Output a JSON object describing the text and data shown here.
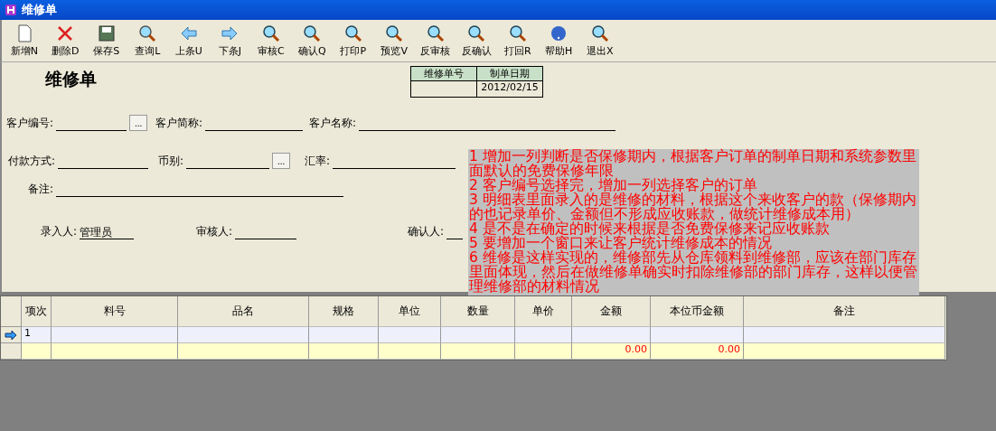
{
  "window": {
    "title": "维修单"
  },
  "toolbar": [
    "新增N",
    "删除D",
    "保存S",
    "查询L",
    "上条U",
    "下条J",
    "审核C",
    "确认Q",
    "打印P",
    "预览V",
    "反审核",
    "反确认",
    "打回R",
    "帮助H",
    "退出X"
  ],
  "form": {
    "heading": "维修单",
    "doc_table": {
      "columns": [
        {
          "header": "维修单号"
        },
        {
          "header": "制单日期",
          "value": "2012/02/15"
        }
      ]
    },
    "rows": [
      [
        {
          "label": "客户编号:",
          "lookup": "..."
        },
        {
          "label": "客户简称:"
        },
        {
          "label": "客户名称:"
        }
      ],
      [
        {
          "label": "付款方式:"
        },
        {
          "label": "币别:",
          "lookup": "..."
        },
        {
          "label": "汇率:"
        }
      ],
      [
        {
          "label": "备注:"
        }
      ],
      [
        {
          "label": "录入人:",
          "value": "管理员"
        },
        {
          "label": "审核人:"
        },
        {
          "label": "确认人:"
        }
      ]
    ]
  },
  "note": [
    "1 增加一列判断是否保修期内，根据客户订单的制单日期和系统参数里面默认的免费保修年限",
    "2 客户编号选择完，增加一列选择客户的订单",
    "3 明细表里面录入的是维修的材料，根据这个来收客户的款（保修期内的也记录单价、金额但不形成应收账款，做统计维修成本用）",
    "4 是不是在确定的时候来根据是否免费保修来记应收账款",
    "5 要增加一个窗口来让客户统计维修成本的情况",
    "6 维修是这样实现的，维修部先从仓库领料到维修部，应该在部门库存里面体现，然后在做维修单确实时扣除维修部的部门库存，这样以便管理维修部的材料情况"
  ],
  "grid": {
    "columns": [
      "项次",
      "料号",
      "品名",
      "规格",
      "单位",
      "数量",
      "单价",
      "金额",
      "本位币金额",
      "备注"
    ],
    "rows": [
      {
        "kind": "item",
        "selected": true,
        "cells": [
          "1",
          null,
          null,
          null,
          null,
          null,
          null,
          null,
          null,
          null
        ]
      },
      {
        "kind": "total",
        "selected": false,
        "cells": [
          null,
          null,
          null,
          null,
          null,
          null,
          null,
          "0.00",
          "0.00",
          null
        ]
      }
    ]
  }
}
